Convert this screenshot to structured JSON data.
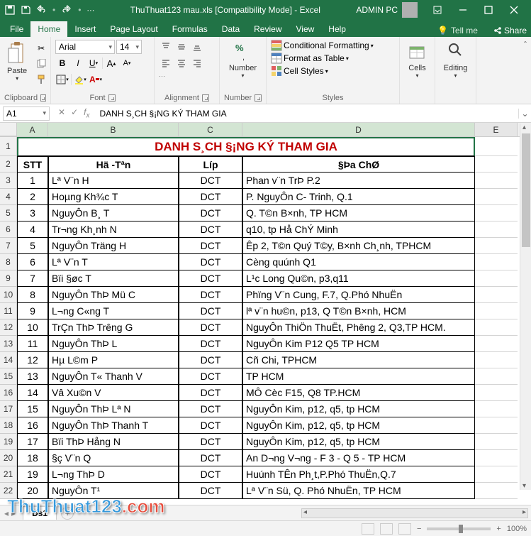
{
  "titlebar": {
    "filename": "ThuThuat123 mau.xls",
    "mode": "[Compatibility Mode]",
    "app": "Excel",
    "user": "ADMIN PC"
  },
  "tabs": {
    "file": "File",
    "items": [
      "Home",
      "Insert",
      "Page Layout",
      "Formulas",
      "Data",
      "Review",
      "View",
      "Help"
    ],
    "active": 0,
    "tellme": "Tell me",
    "share": "Share"
  },
  "ribbon": {
    "clipboard": {
      "label": "Clipboard",
      "paste": "Paste"
    },
    "font": {
      "label": "Font",
      "name": "Arial",
      "size": "14"
    },
    "alignment": {
      "label": "Alignment"
    },
    "number": {
      "label": "Number",
      "btn": "Number"
    },
    "styles": {
      "label": "Styles",
      "cond": "Conditional Formatting",
      "table": "Format as Table",
      "cell": "Cell Styles"
    },
    "cells": {
      "label": "Cells",
      "btn": "Cells"
    },
    "editing": {
      "label": "Editing",
      "btn": "Editing"
    }
  },
  "fbar": {
    "ref": "A1",
    "formula": "DANH S¸CH §¡NG KÝ THAM GIA"
  },
  "columns": [
    "A",
    "B",
    "C",
    "D",
    "E"
  ],
  "sheet": {
    "title": "DANH S¸CH §¡NG KÝ THAM GIA",
    "headers": {
      "stt": "STT",
      "name": "Hä -Tªn",
      "class": "Líp",
      "addr": "§Þa ChØ"
    },
    "rows": [
      {
        "n": "1",
        "name": "Lª V¨n H",
        "cls": "DCT",
        "addr": "Phan v¨n TrÞ P.2"
      },
      {
        "n": "2",
        "name": "Hoµng Kh¾c T",
        "cls": "DCT",
        "addr": "P. NguyÔn C- Trinh, Q.1"
      },
      {
        "n": "3",
        "name": "NguyÔn B¸ T",
        "cls": "DCT",
        "addr": "Q. T©n B×nh, TP HCM"
      },
      {
        "n": "4",
        "name": "Tr¬ng Kh¸nh N",
        "cls": "DCT",
        "addr": "q10, tp Hå ChÝ Minh"
      },
      {
        "n": "5",
        "name": "NguyÔn Träng H",
        "cls": "DCT",
        "addr": "Êp 2, T©n Quý T©y, B×nh Ch¸nh, TPHCM"
      },
      {
        "n": "6",
        "name": "Lª V¨n T",
        "cls": "DCT",
        "addr": "Cèng quúnh Q1"
      },
      {
        "n": "7",
        "name": "Bïi §øc T",
        "cls": "DCT",
        "addr": "L¹c Long Qu©n, p3,q11"
      },
      {
        "n": "8",
        "name": "NguyÔn ThÞ Mü C",
        "cls": "DCT",
        "addr": "Phïng V¨n Cung, F.7, Q.Phó NhuËn"
      },
      {
        "n": "9",
        "name": "L¬ng C«ng T",
        "cls": "DCT",
        "addr": "lª v¨n hu©n, p13, Q T©n B×nh, HCM"
      },
      {
        "n": "10",
        "name": "TrÇn ThÞ Tr­êng G",
        "cls": "DCT",
        "addr": "NguyÔn ThiÖn ThuËt, Ph­êng 2, Q3,TP HCM."
      },
      {
        "n": "11",
        "name": "NguyÔn ThÞ L",
        "cls": "DCT",
        "addr": "NguyÔn Kim P12 Q5 TP HCM"
      },
      {
        "n": "12",
        "name": "Hµ L©m P",
        "cls": "DCT",
        "addr": "Cñ Chi, TPHCM"
      },
      {
        "n": "13",
        "name": "NguyÔn T« Thanh V",
        "cls": "DCT",
        "addr": "TP HCM"
      },
      {
        "n": "14",
        "name": "Vâ Xu©n V",
        "cls": "DCT",
        "addr": "MÔ Cèc F15, Q8 TP.HCM"
      },
      {
        "n": "15",
        "name": "NguyÔn ThÞ Lª N",
        "cls": "DCT",
        "addr": "NguyÔn Kim, p12, q5, tp HCM"
      },
      {
        "n": "16",
        "name": "NguyÔn ThÞ Thanh T",
        "cls": "DCT",
        "addr": "NguyÔn Kim, p12, q5, tp HCM"
      },
      {
        "n": "17",
        "name": "Bïi ThÞ Hång N",
        "cls": "DCT",
        "addr": "NguyÔn Kim, p12, q5, tp HCM"
      },
      {
        "n": "18",
        "name": "§ç V¨n Q",
        "cls": "DCT",
        "addr": "An D­¬ng V­¬ng - F 3 - Q 5 - TP HCM"
      },
      {
        "n": "19",
        "name": " L¬ng ThÞ D",
        "cls": "DCT",
        "addr": "Huúnh TÊn Ph¸t,P.Phó ThuËn,Q.7"
      },
      {
        "n": "20",
        "name": "NguyÔn T¹",
        "cls": "DCT",
        "addr": "Lª V¨n Sü, Q. Phó NhuËn, TP HCM"
      }
    ]
  },
  "sheettab": "Ds1",
  "status": {
    "ready": "",
    "zoom": "100%"
  },
  "watermark": {
    "a": "ThuThuat123",
    "b": ".com"
  }
}
